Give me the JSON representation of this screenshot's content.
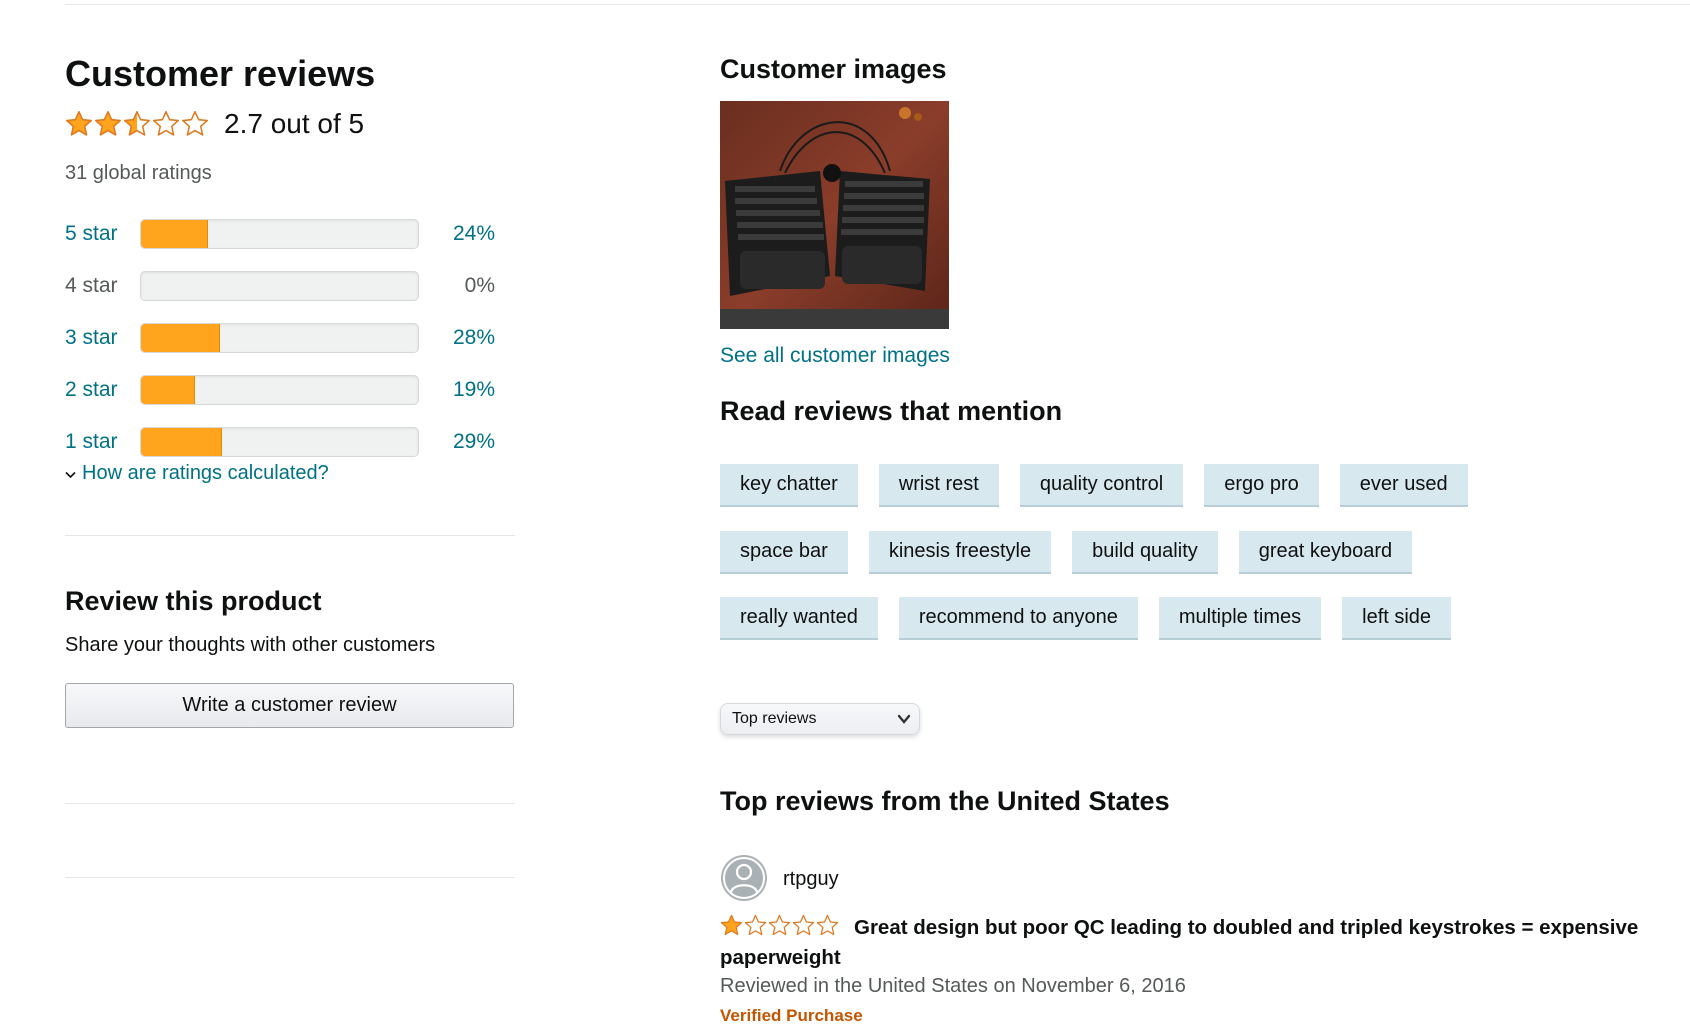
{
  "summary": {
    "heading": "Customer reviews",
    "stars": 2.7,
    "rating_text": "2.7 out of 5",
    "global_ratings": "31 global ratings"
  },
  "histogram": [
    {
      "label": "5 star",
      "percent": 24,
      "percent_text": "24%",
      "link": true
    },
    {
      "label": "4 star",
      "percent": 0,
      "percent_text": "0%",
      "link": false
    },
    {
      "label": "3 star",
      "percent": 28,
      "percent_text": "28%",
      "link": true
    },
    {
      "label": "2 star",
      "percent": 19,
      "percent_text": "19%",
      "link": true
    },
    {
      "label": "1 star",
      "percent": 29,
      "percent_text": "29%",
      "link": true
    }
  ],
  "how_calculated": "How are ratings calculated?",
  "review_product": {
    "heading": "Review this product",
    "subtext": "Share your thoughts with other customers",
    "button": "Write a customer review"
  },
  "customer_images": {
    "heading": "Customer images",
    "see_all": "See all customer images"
  },
  "mentions": {
    "heading": "Read reviews that mention",
    "chips": [
      "key chatter",
      "wrist rest",
      "quality control",
      "ergo pro",
      "ever used",
      "space bar",
      "kinesis freestyle",
      "build quality",
      "great keyboard",
      "really wanted",
      "recommend to anyone",
      "multiple times",
      "left side"
    ]
  },
  "sort": {
    "selected": "Top reviews"
  },
  "top_reviews": {
    "heading": "Top reviews from the United States",
    "reviews": [
      {
        "reviewer": "rtpguy",
        "stars": 1,
        "title": "Great design but poor QC leading to doubled and tripled keystrokes = expensive paperweight",
        "date": "Reviewed in the United States on November 6, 2016",
        "verified": "Verified Purchase"
      }
    ]
  },
  "colors": {
    "link": "#007185",
    "bar_fill": "#ffa41c",
    "star": "#ffa41c",
    "verified": "#c45500",
    "chip_bg": "#d7e8ee"
  }
}
